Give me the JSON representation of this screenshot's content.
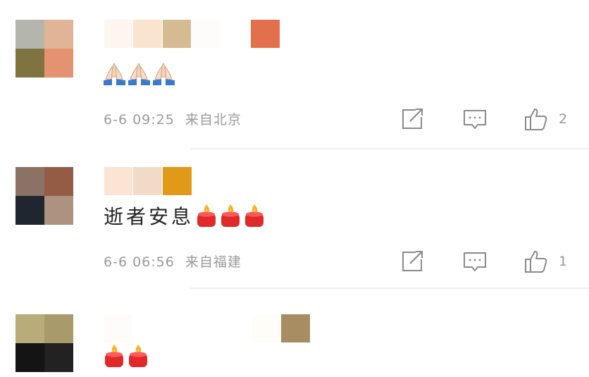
{
  "colors": {
    "text_primary": "#222222",
    "text_meta": "#9a9a9a",
    "icon_gray": "#8a8a8a",
    "divider": "#efefef",
    "candle_red": "#e02a2a",
    "candle_flame": "#ffb020"
  },
  "comments": [
    {
      "avatar_icon": "blurred-avatar",
      "text": "",
      "emojis": [
        "folded-hands-icon",
        "folded-hands-icon",
        "folded-hands-icon"
      ],
      "date": "6-6",
      "time": "09:25",
      "location": "来自北京",
      "like_count": "2"
    },
    {
      "avatar_icon": "blurred-avatar",
      "text": "逝者安息",
      "emojis": [
        "candle-icon",
        "candle-icon",
        "candle-icon"
      ],
      "date": "6-6",
      "time": "06:56",
      "location": "来自福建",
      "like_count": "1"
    },
    {
      "avatar_icon": "blurred-avatar",
      "text": "",
      "emojis": [
        "candle-icon",
        "candle-icon"
      ]
    }
  ],
  "action_icons": {
    "share": "share-icon",
    "reply": "comment-icon",
    "like": "thumbs-up-icon"
  }
}
